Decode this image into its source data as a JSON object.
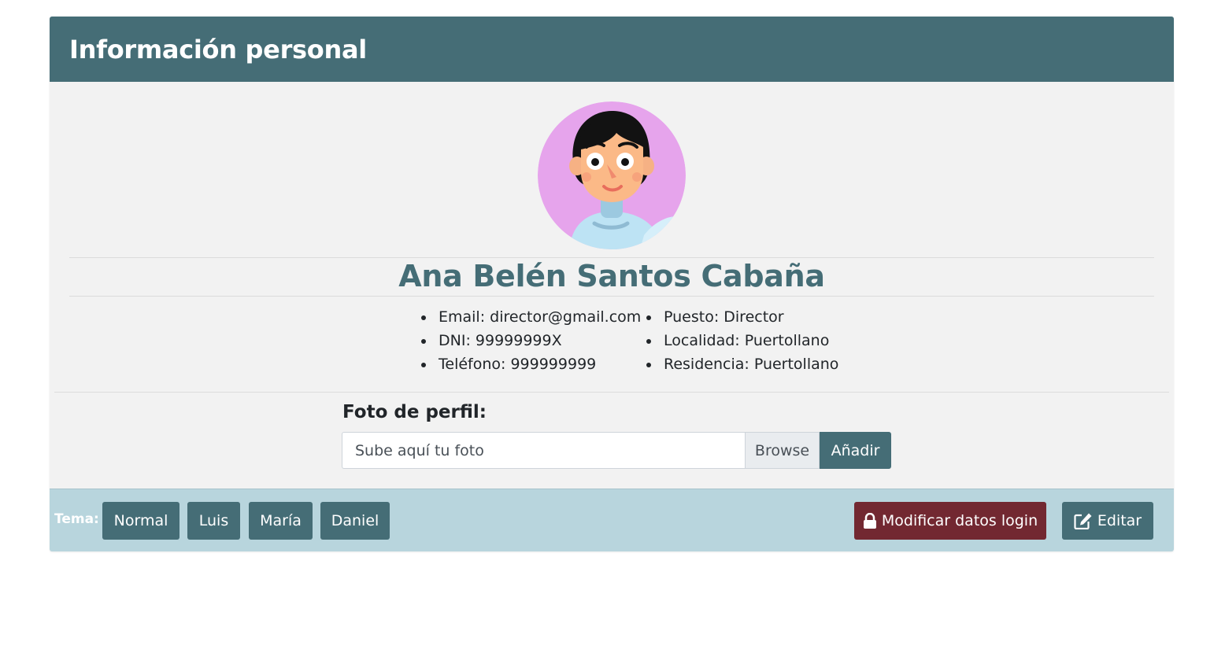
{
  "header": {
    "title": "Información personal"
  },
  "profile": {
    "name": "Ana Belén Santos Cabaña",
    "left_items": [
      "Email: director@gmail.com",
      "DNI: 99999999X",
      "Teléfono: 999999999"
    ],
    "right_items": [
      "Puesto: Director",
      "Localidad: Puertollano",
      "Residencia: Puertollano"
    ]
  },
  "upload": {
    "label": "Foto de perfil:",
    "placeholder": "Sube aquí tu foto",
    "browse": "Browse",
    "add": "Añadir"
  },
  "footer": {
    "theme_label": "Tema:",
    "themes": [
      "Normal",
      "Luis",
      "María",
      "Daniel"
    ],
    "login_button": "Modificar datos login",
    "edit_button": "Editar"
  },
  "colors": {
    "primary": "#456d76",
    "danger": "#722831",
    "footer_bg": "#b8d5dd",
    "card_bg": "#f2f2f2",
    "avatar_bg": "#e6a4ec"
  }
}
